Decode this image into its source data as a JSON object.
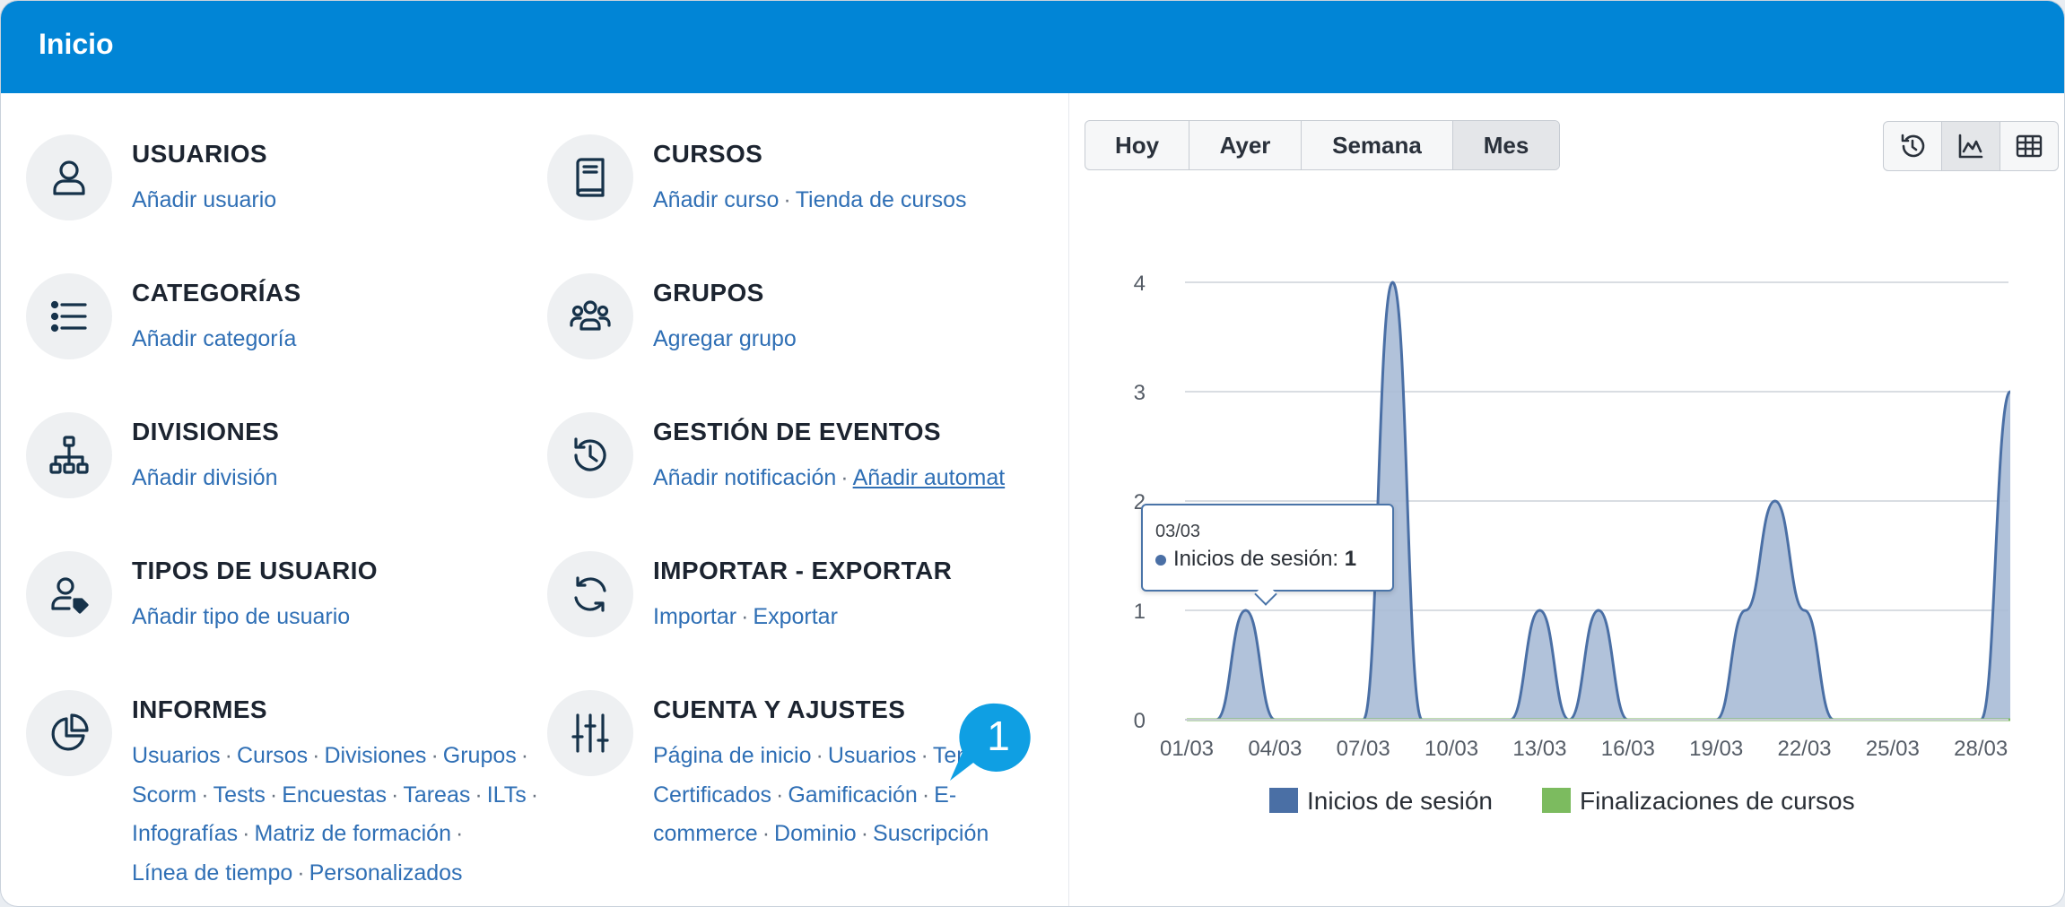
{
  "header": {
    "title": "Inicio"
  },
  "modules": [
    {
      "title": "USUARIOS",
      "icon": "user-icon",
      "rows": [
        [
          {
            "t": "Añadir usuario"
          }
        ]
      ]
    },
    {
      "title": "CURSOS",
      "icon": "book-icon",
      "rows": [
        [
          {
            "t": "Añadir curso"
          },
          {
            "t": "Tienda de cursos"
          }
        ]
      ]
    },
    {
      "title": "CATEGORÍAS",
      "icon": "list-icon",
      "rows": [
        [
          {
            "t": "Añadir categoría"
          }
        ]
      ]
    },
    {
      "title": "GRUPOS",
      "icon": "group-icon",
      "rows": [
        [
          {
            "t": "Agregar grupo"
          }
        ]
      ]
    },
    {
      "title": "DIVISIONES",
      "icon": "hierarchy-icon",
      "rows": [
        [
          {
            "t": "Añadir división"
          }
        ]
      ]
    },
    {
      "title": "GESTIÓN DE EVENTOS",
      "icon": "history-icon",
      "rows": [
        [
          {
            "t": "Añadir notificación"
          },
          {
            "t": "Añadir automat",
            "u": true
          }
        ]
      ]
    },
    {
      "title": "TIPOS DE USUARIO",
      "icon": "user-tag-icon",
      "rows": [
        [
          {
            "t": "Añadir tipo de usuario"
          }
        ]
      ]
    },
    {
      "title": "IMPORTAR - EXPORTAR",
      "icon": "sync-icon",
      "rows": [
        [
          {
            "t": "Importar"
          },
          {
            "t": "Exportar"
          }
        ]
      ]
    },
    {
      "title": "INFORMES",
      "icon": "pie-chart-icon",
      "rows": [
        [
          {
            "t": "Usuarios"
          },
          {
            "t": "Cursos"
          },
          {
            "t": "Divisiones"
          },
          {
            "t": "Grupos"
          },
          {
            "t": "",
            "sepOnly": true
          }
        ],
        [
          {
            "t": "Scorm"
          },
          {
            "t": "Tests"
          },
          {
            "t": "Encuestas"
          },
          {
            "t": "Tareas"
          },
          {
            "t": "ILTs"
          },
          {
            "t": "",
            "sepOnly": true
          }
        ],
        [
          {
            "t": "Infografías"
          },
          {
            "t": "Matriz de formación"
          },
          {
            "t": "",
            "sepOnly": true
          }
        ],
        [
          {
            "t": "Línea de tiempo"
          },
          {
            "t": "Personalizados"
          }
        ]
      ]
    },
    {
      "title": "CUENTA Y AJUSTES",
      "icon": "sliders-icon",
      "rows": [
        [
          {
            "t": "Página de inicio"
          },
          {
            "t": "Usuarios"
          },
          {
            "t": "Tema"
          }
        ],
        [
          {
            "t": "Certificados"
          },
          {
            "t": "Gamificación"
          },
          {
            "t": "E-"
          }
        ],
        [
          {
            "t": "commerce"
          },
          {
            "t": "Dominio"
          },
          {
            "t": "Suscripción"
          }
        ]
      ]
    }
  ],
  "separator": "·",
  "badge": {
    "number": "1",
    "color": "#0f9fe3"
  },
  "period_tabs": [
    "Hoy",
    "Ayer",
    "Semana",
    "Mes"
  ],
  "period_selected": "Mes",
  "view_icons": [
    "history-icon",
    "area-chart-icon",
    "table-icon"
  ],
  "view_selected": "area-chart-icon",
  "tooltip": {
    "date": "03/03",
    "label": "Inicios de sesión:",
    "value": "1"
  },
  "chart_data": {
    "type": "area",
    "categories": [
      "01/03",
      "02/03",
      "03/03",
      "04/03",
      "05/03",
      "06/03",
      "07/03",
      "08/03",
      "09/03",
      "10/03",
      "11/03",
      "12/03",
      "13/03",
      "14/03",
      "15/03",
      "16/03",
      "17/03",
      "18/03",
      "19/03",
      "20/03",
      "21/03",
      "22/03",
      "23/03",
      "24/03",
      "25/03",
      "26/03",
      "27/03",
      "28/03",
      "29/03"
    ],
    "x_tick_labels": [
      "01/03",
      "04/03",
      "07/03",
      "10/03",
      "13/03",
      "16/03",
      "19/03",
      "22/03",
      "25/03",
      "28/03"
    ],
    "ylim": [
      0,
      4
    ],
    "y_ticks": [
      0,
      1,
      2,
      3,
      4
    ],
    "grid": true,
    "legend_position": "bottom",
    "series": [
      {
        "name": "Inicios de sesión",
        "color": "#4a6fa5",
        "values": [
          0,
          0,
          1,
          0,
          0,
          0,
          0,
          4,
          0,
          0,
          0,
          0,
          1,
          0,
          1,
          0,
          0,
          0,
          0,
          1,
          2,
          1,
          0,
          0,
          0,
          0,
          0,
          0,
          3
        ]
      },
      {
        "name": "Finalizaciones de cursos",
        "color": "#7cbb5f",
        "values": [
          0,
          0,
          0,
          0,
          0,
          0,
          0,
          0,
          0,
          0,
          0,
          0,
          0,
          0,
          0,
          0,
          0,
          0,
          0,
          0,
          0,
          0,
          0,
          0,
          0,
          0,
          0,
          0,
          0
        ]
      }
    ]
  }
}
